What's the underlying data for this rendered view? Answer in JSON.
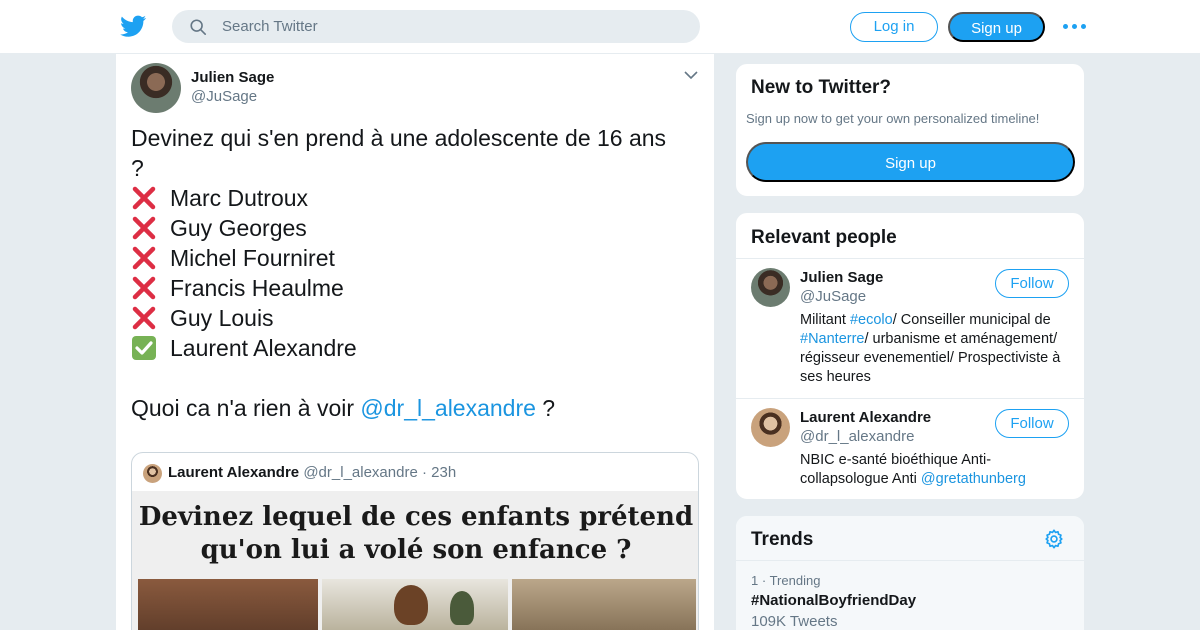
{
  "header": {
    "search_placeholder": "Search Twitter",
    "login_label": "Log in",
    "signup_label": "Sign up"
  },
  "tweet": {
    "author_name": "Julien Sage",
    "author_handle": "@JuSage",
    "intro_line1": "Devinez qui s'en prend à une adolescente de 16 ans",
    "intro_line2": "?",
    "items": [
      {
        "mark": "cross",
        "name": "Marc Dutroux"
      },
      {
        "mark": "cross",
        "name": "Guy Georges"
      },
      {
        "mark": "cross",
        "name": "Michel Fourniret"
      },
      {
        "mark": "cross",
        "name": "Francis Heaulme"
      },
      {
        "mark": "cross",
        "name": "Guy Louis"
      },
      {
        "mark": "check",
        "name": "Laurent Alexandre"
      }
    ],
    "closing_text": "Quoi ca n'a rien à voir ",
    "closing_mention": "@dr_l_alexandre",
    "closing_suffix": " ?",
    "quote": {
      "name": "Laurent Alexandre",
      "handle": "@dr_l_alexandre",
      "dot": "·",
      "time": "23h",
      "image_caption_line1": "Devinez lequel de ces enfants prétend",
      "image_caption_line2": "qu'on lui a volé son enfance ?"
    }
  },
  "sidebar": {
    "new_to_twitter": {
      "title": "New to Twitter?",
      "subtitle": "Sign up now to get your own personalized timeline!",
      "button": "Sign up"
    },
    "relevant_people": {
      "title": "Relevant people",
      "people": [
        {
          "name": "Julien Sage",
          "handle": "@JuSage",
          "follow": "Follow",
          "bio_parts": [
            {
              "text": "Militant ",
              "link": false
            },
            {
              "text": "#ecolo",
              "link": true
            },
            {
              "text": "/ Conseiller municipal de ",
              "link": false
            },
            {
              "text": "#Nanterre",
              "link": true
            },
            {
              "text": "/ urbanisme et aménagement/ régisseur evenementiel/ Prospectiviste à ses heures",
              "link": false
            }
          ]
        },
        {
          "name": "Laurent Alexandre",
          "handle": "@dr_l_alexandre",
          "follow": "Follow",
          "bio_parts": [
            {
              "text": "NBIC e-santé bioéthique Anti-collapsologue Anti ",
              "link": false
            },
            {
              "text": "@gretathunberg",
              "link": true
            }
          ]
        }
      ]
    },
    "trends": {
      "title": "Trends",
      "items": [
        {
          "rank": "1",
          "sep": "·",
          "label": "Trending",
          "name": "#NationalBoyfriendDay",
          "count": "109K Tweets"
        }
      ]
    }
  },
  "colors": {
    "accent": "#1da1f2",
    "link": "#1b95e0",
    "cross": "#dd2e44",
    "check": "#77b255"
  }
}
